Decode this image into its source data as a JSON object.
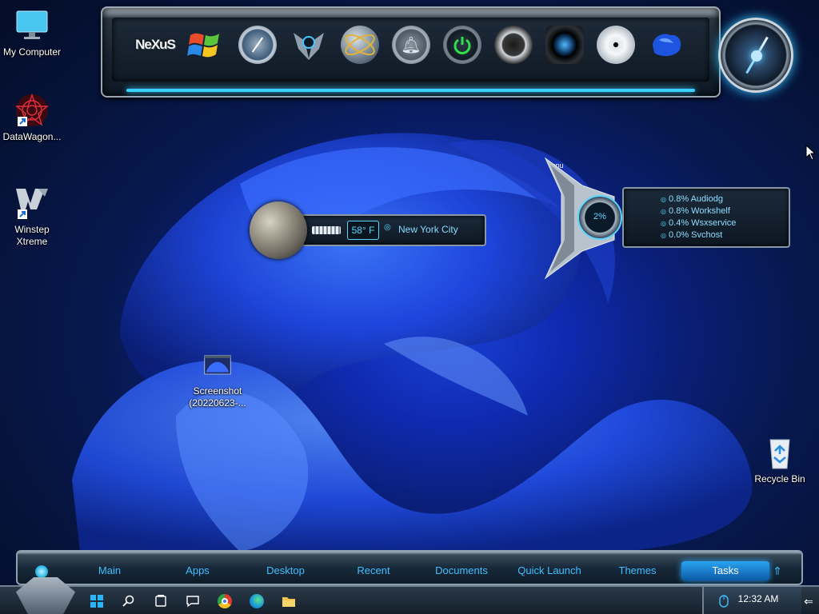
{
  "desktop": {
    "icons": [
      {
        "label": "My Computer"
      },
      {
        "label": "DataWagon..."
      },
      {
        "label": "Winstep Xtreme"
      },
      {
        "label_line1": "Screenshot",
        "label_line2": "(20220623-..."
      },
      {
        "label": "Recycle Bin"
      }
    ]
  },
  "dock": {
    "items": [
      {
        "name": "nexus-logo-icon",
        "label": "NeXuS"
      },
      {
        "name": "windows-logo-icon"
      },
      {
        "name": "compass-icon"
      },
      {
        "name": "robot-icon"
      },
      {
        "name": "globe-icon"
      },
      {
        "name": "bell-icon"
      },
      {
        "name": "power-icon"
      },
      {
        "name": "speaker-icon"
      },
      {
        "name": "camera-lens-icon"
      },
      {
        "name": "disc-icon"
      },
      {
        "name": "blue-gem-icon"
      }
    ]
  },
  "weather": {
    "temp": "58° F",
    "city": "New York City"
  },
  "cpu": {
    "label": "cpu",
    "percent": "2%",
    "processes": [
      "0.8% Audiodg",
      "0.8% Workshelf",
      "0.4% Wsxservice",
      "0.0% Svchost"
    ]
  },
  "shelf": {
    "tabs": [
      "Main",
      "Apps",
      "Desktop",
      "Recent",
      "Documents",
      "Quick Launch",
      "Themes",
      "Tasks"
    ],
    "active": "Tasks"
  },
  "taskbar": {
    "time": "12:32 AM"
  }
}
